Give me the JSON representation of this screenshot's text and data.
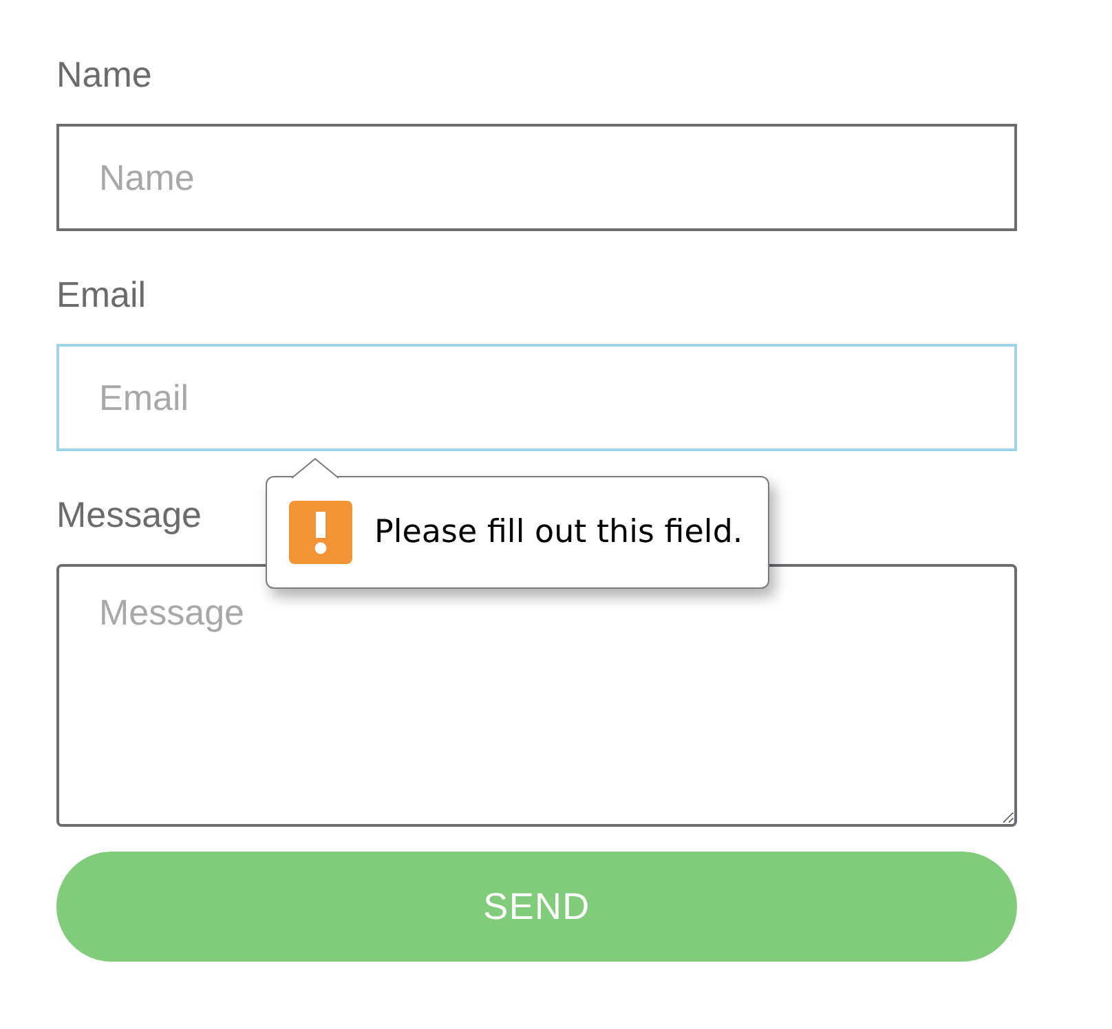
{
  "fields": [
    {
      "label": "Name",
      "placeholder": "Name",
      "kind": "input",
      "focused": false
    },
    {
      "label": "Email",
      "placeholder": "Email",
      "kind": "input",
      "focused": true,
      "error": "Please fill out this field."
    },
    {
      "label": "Message",
      "placeholder": "Message",
      "kind": "textarea",
      "focused": false
    }
  ],
  "button": {
    "label": "SEND"
  }
}
